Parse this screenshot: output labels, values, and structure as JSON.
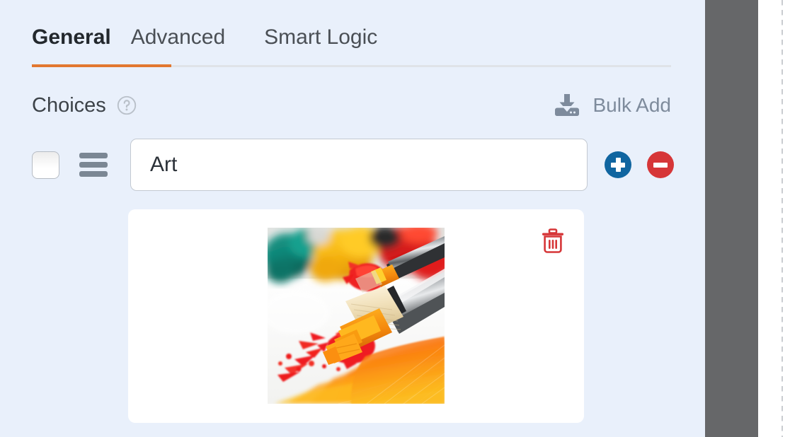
{
  "theme": {
    "panel_bg": "#e9f0fb",
    "accent_orange": "#e27730",
    "add_blue": "#1065a0",
    "remove_red": "#d63638",
    "trash_red": "#d63638",
    "muted_slate": "#7e8b9c",
    "rail_gray": "#666769"
  },
  "tabs": [
    {
      "label": "General",
      "active": true
    },
    {
      "label": "Advanced",
      "active": false
    },
    {
      "label": "Smart Logic",
      "active": false
    }
  ],
  "choices_section": {
    "title": "Choices",
    "help_icon": "question-circle-icon",
    "bulk_add": {
      "label": "Bulk Add",
      "icon": "download-import-icon"
    }
  },
  "choice_rows": [
    {
      "checkbox_checked": false,
      "drag_handle_icon": "drag-handle-icon",
      "value": "Art",
      "placeholder": "",
      "add_button": {
        "icon": "plus-circle-icon",
        "label": "+"
      },
      "remove_button": {
        "icon": "minus-circle-icon",
        "label": "−"
      },
      "image_card": {
        "delete_icon": "trash-icon",
        "image_alt": "Paintbrush with red and orange paint on canvas, teal and yellow paint blobs"
      }
    }
  ]
}
